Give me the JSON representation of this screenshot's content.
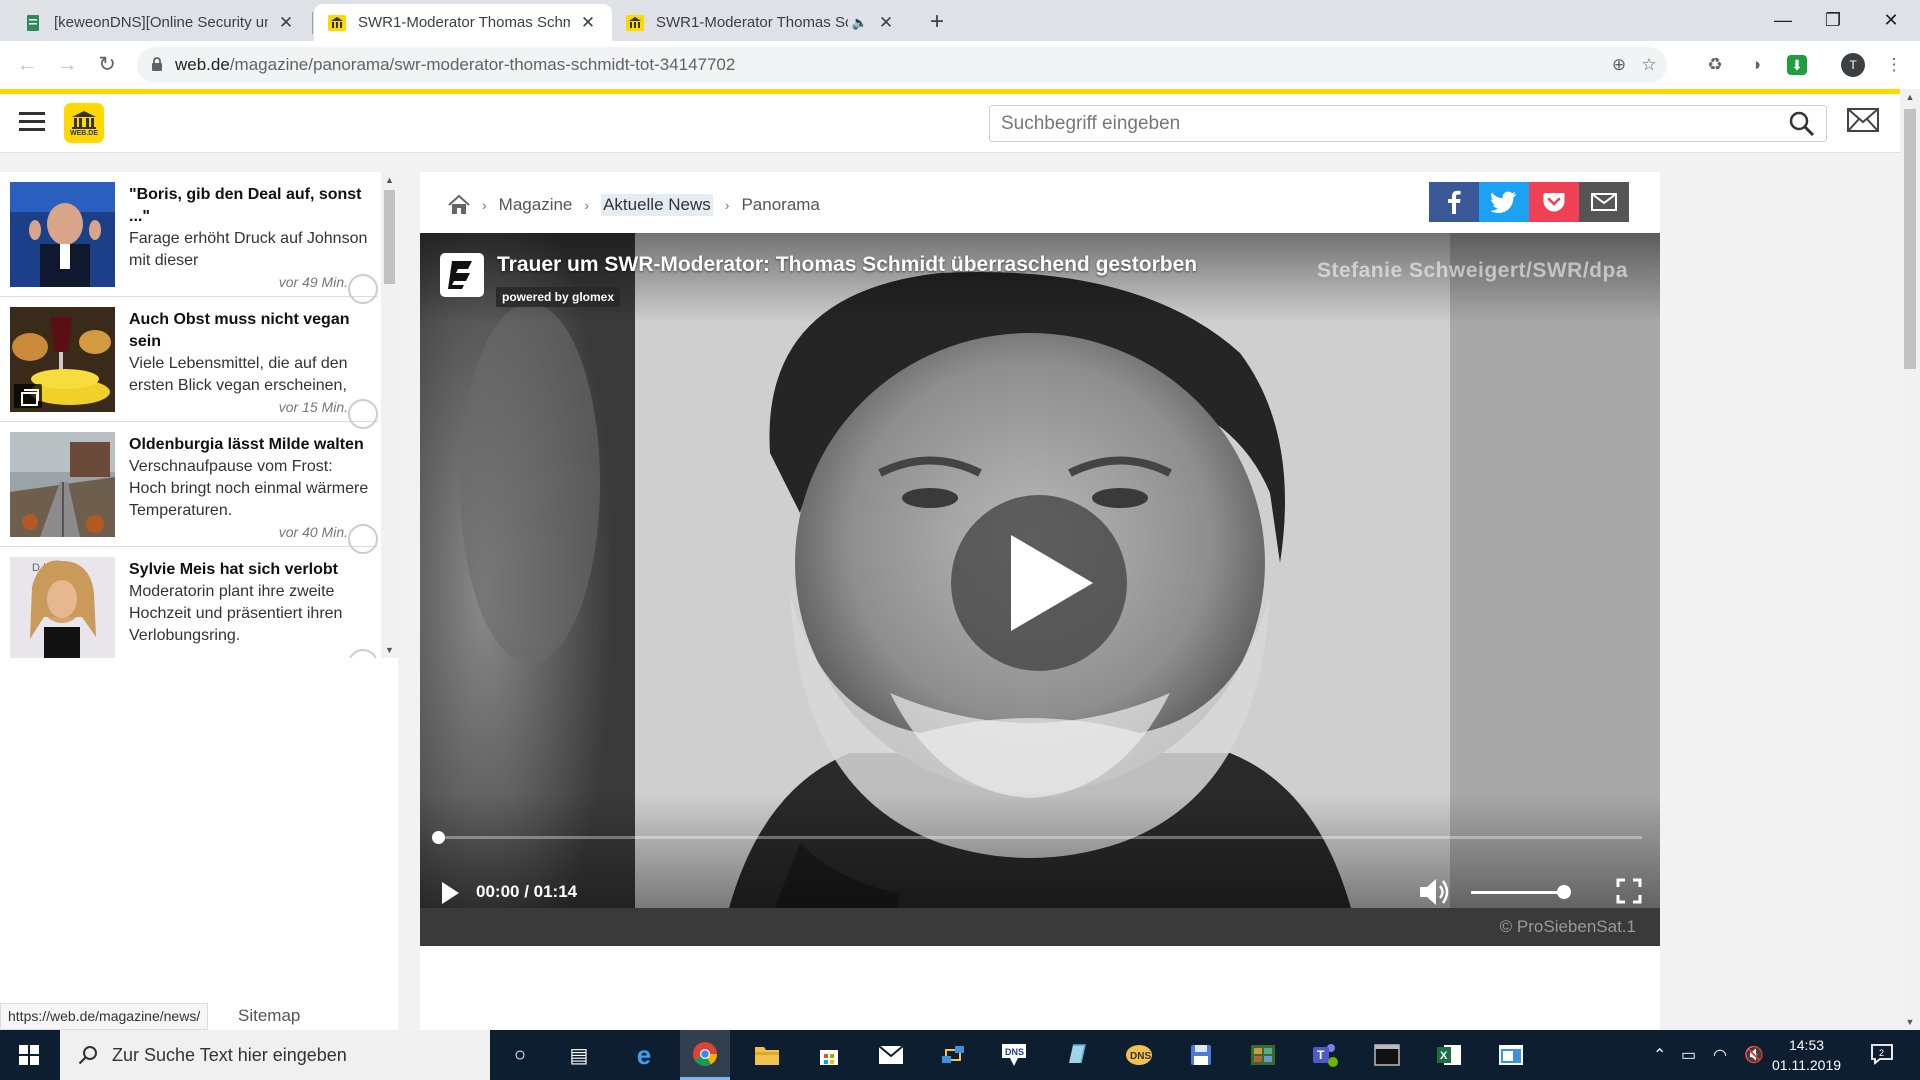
{
  "browser": {
    "tabs": [
      {
        "title": "[keweonDNS][Online Security un",
        "active": false
      },
      {
        "title": "SWR1-Moderator Thomas Schmi",
        "active": true
      },
      {
        "title": "SWR1-Moderator Thomas Sc",
        "active": false
      }
    ],
    "url_domain": "web.de",
    "url_path": "/magazine/panorama/swr-moderator-thomas-schmidt-tot-34147702",
    "profile_initial": "T"
  },
  "site": {
    "logo_text": "WEB.DE",
    "search_placeholder": "Suchbegriff eingeben"
  },
  "news": [
    {
      "headline": "\"Boris, gib den Deal auf, sonst ...\"",
      "teaser": "Farage erhöht Druck auf Johnson mit dieser",
      "time": "vor 49 Min."
    },
    {
      "headline": "Auch Obst muss nicht vegan sein",
      "teaser": "Viele Lebensmittel, die auf den ersten Blick vegan erscheinen,",
      "time": "vor 15 Min."
    },
    {
      "headline": "Oldenburgia lässt Milde walten",
      "teaser": "Verschnaufpause vom Frost: Hoch bringt noch einmal wärmere Temperaturen.",
      "time": "vor 40 Min."
    },
    {
      "headline": "Sylvie Meis hat sich verlobt",
      "teaser": "Moderatorin plant ihre zweite Hochzeit und präsentiert ihren Verlobungsring.",
      "time": ""
    }
  ],
  "thumb_overlays": {
    "news4_caption": "D LAS"
  },
  "breadcrumb": [
    "Magazine",
    "Aktuelle News",
    "Panorama"
  ],
  "share": {
    "facebook": "f",
    "twitter": "t",
    "pocket": "p",
    "email": "@"
  },
  "video": {
    "title": "Trauer um SWR-Moderator: Thomas Schmidt überraschend gestorben",
    "powered_by": "powered by glomex",
    "credit": "Stefanie Schweigert/SWR/dpa",
    "time": "00:00 / 01:14",
    "progress": 0.0,
    "volume": 1.0,
    "copyright": "© ProSiebenSat.1"
  },
  "status_bar": {
    "url": "https://web.de/magazine/news/"
  },
  "footer": {
    "sitemap": "Sitemap"
  },
  "taskbar": {
    "search_placeholder": "Zur Suche Text hier eingeben",
    "time": "14:53",
    "date": "01.11.2019",
    "notification_count": "2",
    "dns_label": "DNS"
  },
  "colors": {
    "accent_yellow": "#ffd800",
    "facebook": "#3b5998",
    "twitter": "#1da1f2",
    "pocket": "#ef4056",
    "email": "#555555"
  }
}
